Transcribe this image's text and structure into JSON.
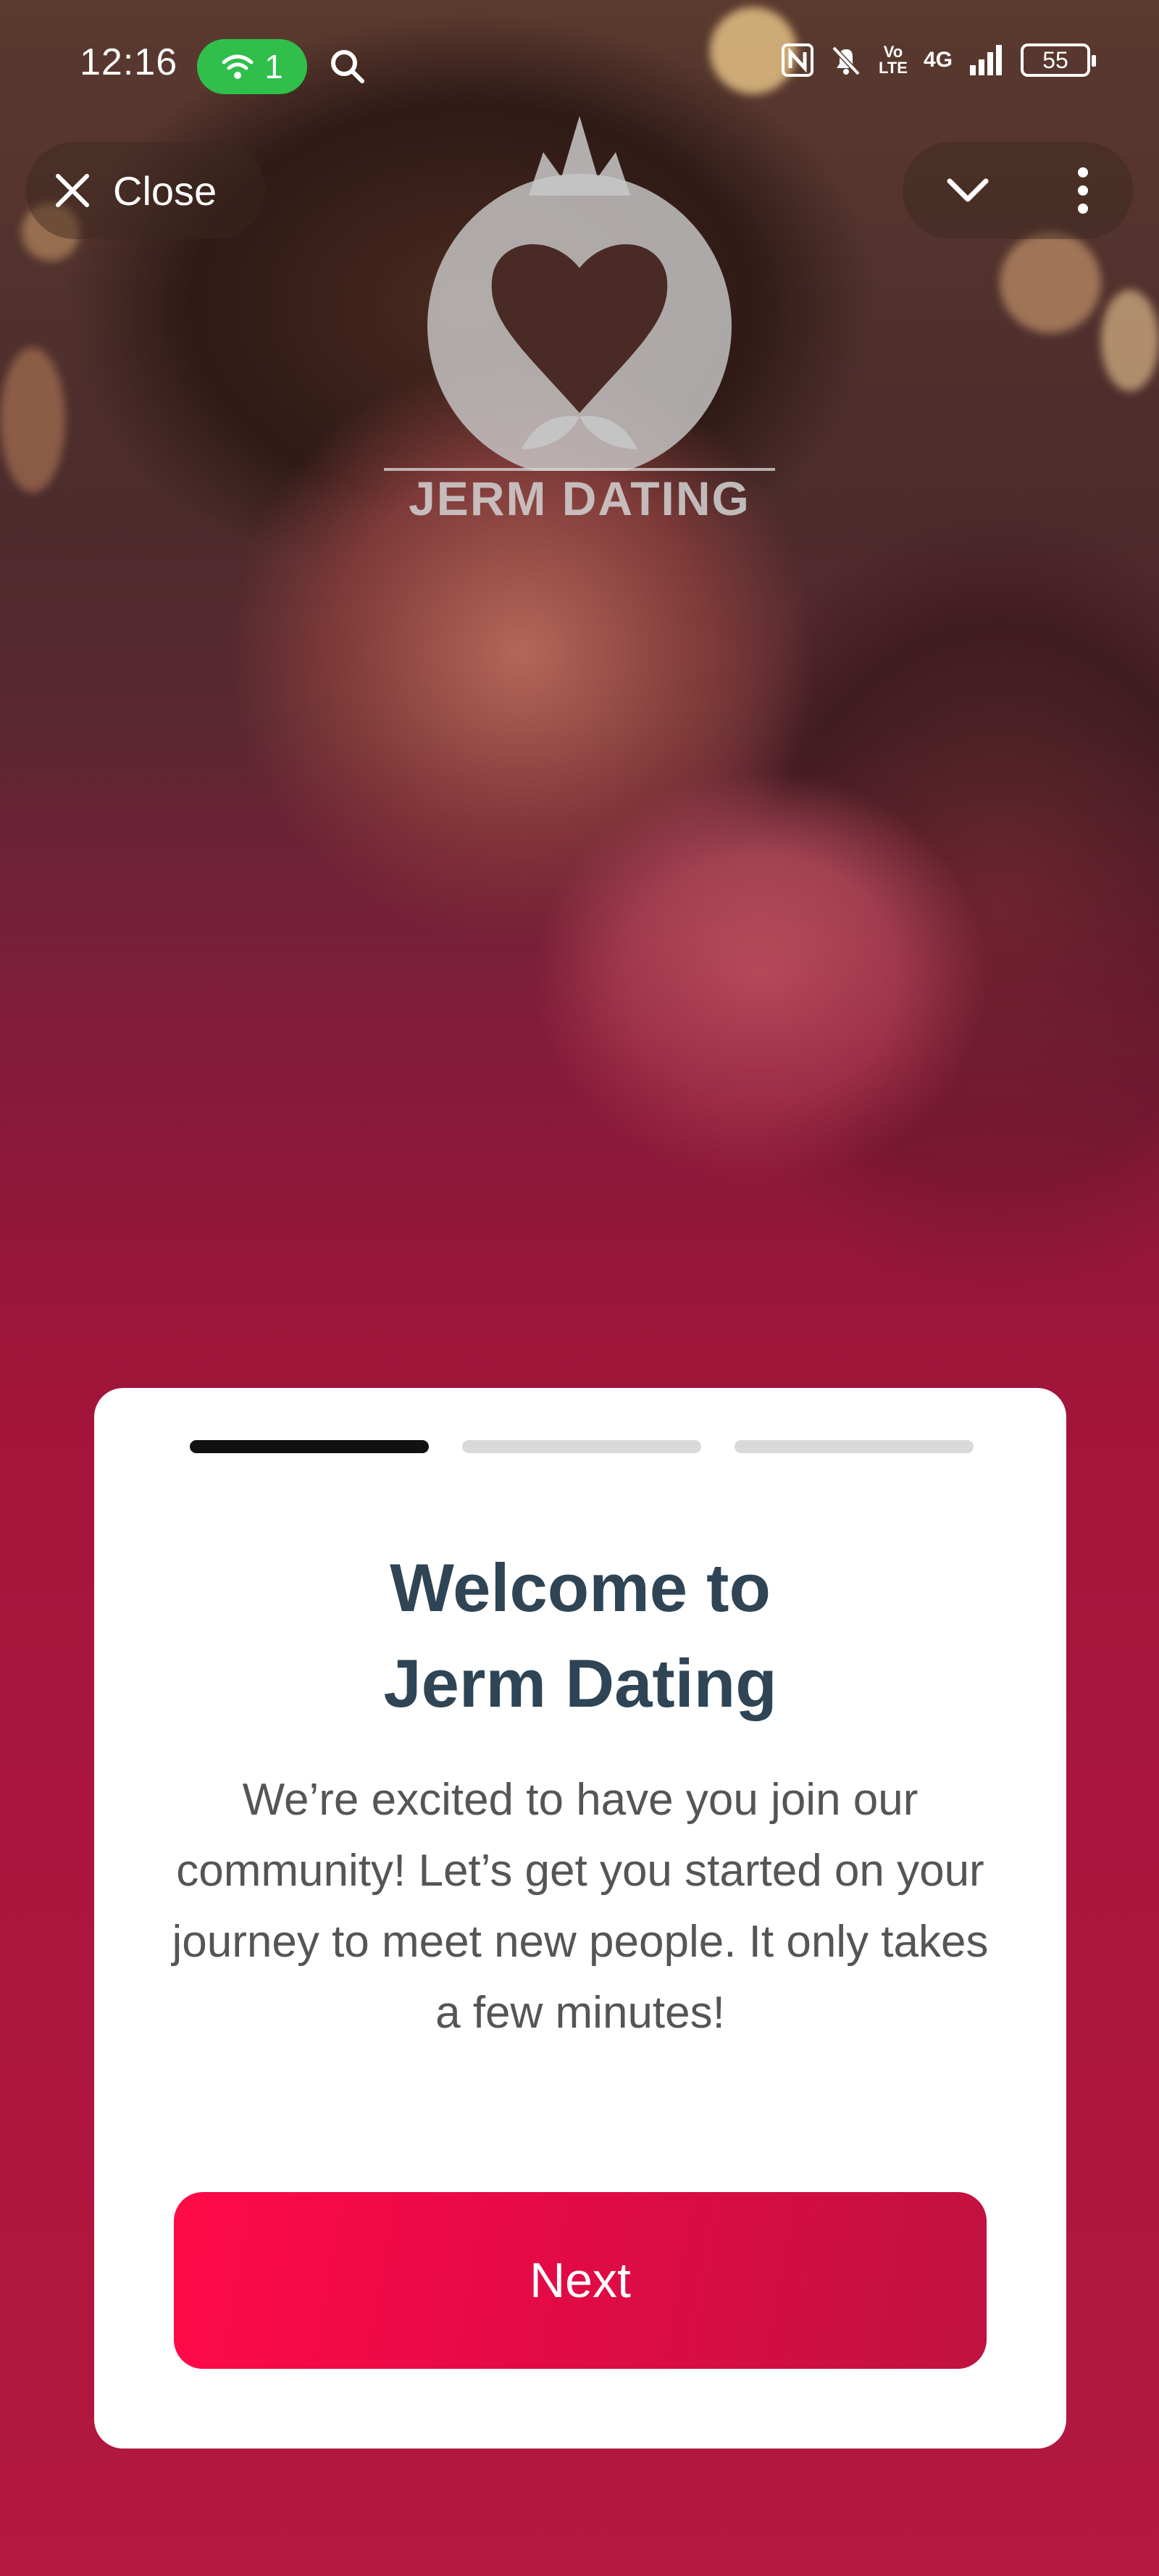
{
  "status_bar": {
    "time": "12:16",
    "wifi_count": "1",
    "battery": "55",
    "network": "4G",
    "volte": "Vo LTE"
  },
  "top_bar": {
    "close_label": "Close"
  },
  "logo": {
    "text": "JERM DATING"
  },
  "card": {
    "steps_total": 3,
    "current_step": 1,
    "title_line1": "Welcome to",
    "title_line2": "Jerm Dating",
    "description": "We’re excited to have you join our community! Let’s get you started on your journey to meet new people. It only takes a few minutes!",
    "next_label": "Next"
  },
  "colors": {
    "accent": "#ff0a47",
    "title": "#2f4454",
    "background": "#a8163f",
    "wifi_pill": "#2fbf4a"
  }
}
